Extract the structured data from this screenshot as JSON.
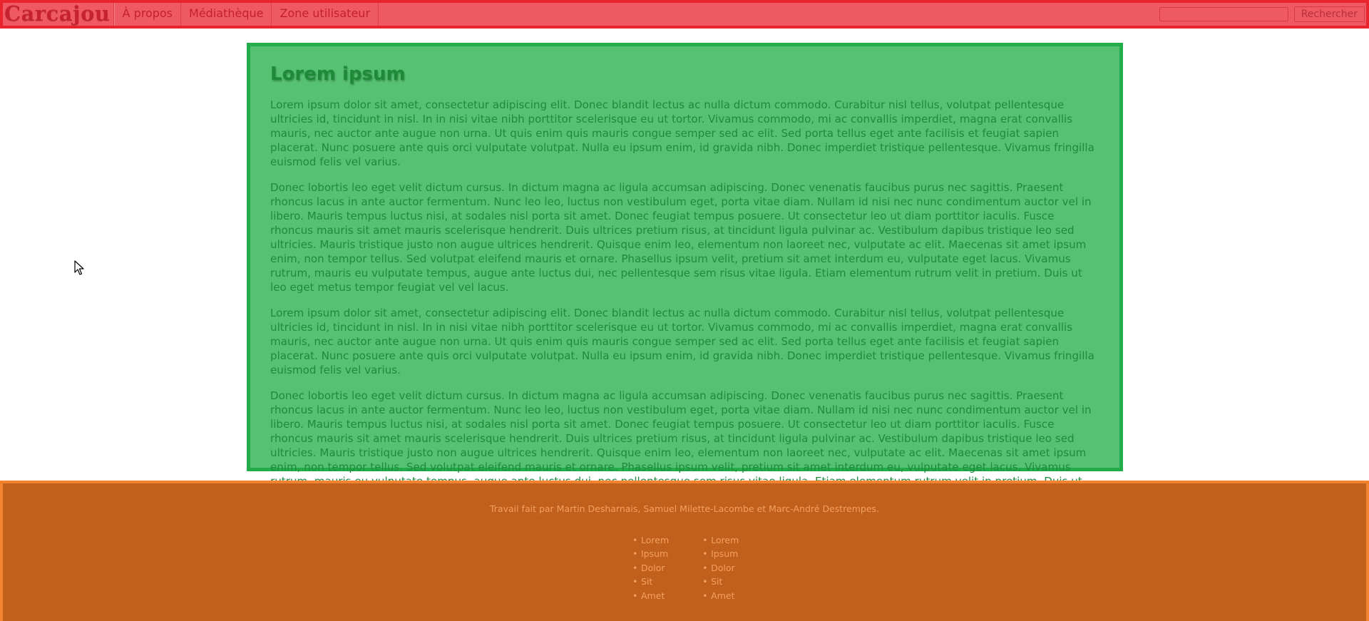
{
  "header": {
    "brand": "Carcajou",
    "nav": [
      "À propos",
      "Médiathèque",
      "Zone utilisateur"
    ],
    "search": {
      "value": "",
      "placeholder": "",
      "button_label": "Rechercher"
    }
  },
  "main": {
    "title": "Lorem ipsum",
    "paragraphs": [
      "Lorem ipsum dolor sit amet, consectetur adipiscing elit. Donec blandit lectus ac nulla dictum commodo. Curabitur nisl tellus, volutpat pellentesque ultricies id, tincidunt in nisl. In in nisi vitae nibh porttitor scelerisque eu ut tortor. Vivamus commodo, mi ac convallis imperdiet, magna erat convallis mauris, nec auctor ante augue non urna. Ut quis enim quis mauris congue semper sed ac elit. Sed porta tellus eget ante facilisis et feugiat sapien placerat. Nunc posuere ante quis orci vulputate volutpat. Nulla eu ipsum enim, id gravida nibh. Donec imperdiet tristique pellentesque. Vivamus fringilla euismod felis vel varius.",
      "Donec lobortis leo eget velit dictum cursus. In dictum magna ac ligula accumsan adipiscing. Donec venenatis faucibus purus nec sagittis. Praesent rhoncus lacus in ante auctor fermentum. Nunc leo leo, luctus non vestibulum eget, porta vitae diam. Nullam id nisi nec nunc condimentum auctor vel in libero. Mauris tempus luctus nisi, at sodales nisl porta sit amet. Donec feugiat tempus posuere. Ut consectetur leo ut diam porttitor iaculis. Fusce rhoncus mauris sit amet mauris scelerisque hendrerit. Duis ultrices pretium risus, at tincidunt ligula pulvinar ac. Vestibulum dapibus tristique leo sed ultricies. Mauris tristique justo non augue ultrices hendrerit. Quisque enim leo, elementum non laoreet nec, vulputate ac elit. Maecenas sit amet ipsum enim, non tempor tellus. Sed volutpat eleifend mauris et ornare. Phasellus ipsum velit, pretium sit amet interdum eu, vulputate eget lacus. Vivamus rutrum, mauris eu vulputate tempus, augue ante luctus dui, nec pellentesque sem risus vitae ligula. Etiam elementum rutrum velit in pretium. Duis ut leo eget metus tempor feugiat vel vel lacus.",
      "Lorem ipsum dolor sit amet, consectetur adipiscing elit. Donec blandit lectus ac nulla dictum commodo. Curabitur nisl tellus, volutpat pellentesque ultricies id, tincidunt in nisl. In in nisi vitae nibh porttitor scelerisque eu ut tortor. Vivamus commodo, mi ac convallis imperdiet, magna erat convallis mauris, nec auctor ante augue non urna. Ut quis enim quis mauris congue semper sed ac elit. Sed porta tellus eget ante facilisis et feugiat sapien placerat. Nunc posuere ante quis orci vulputate volutpat. Nulla eu ipsum enim, id gravida nibh. Donec imperdiet tristique pellentesque. Vivamus fringilla euismod felis vel varius.",
      "Donec lobortis leo eget velit dictum cursus. In dictum magna ac ligula accumsan adipiscing. Donec venenatis faucibus purus nec sagittis. Praesent rhoncus lacus in ante auctor fermentum. Nunc leo leo, luctus non vestibulum eget, porta vitae diam. Nullam id nisi nec nunc condimentum auctor vel in libero. Mauris tempus luctus nisi, at sodales nisl porta sit amet. Donec feugiat tempus posuere. Ut consectetur leo ut diam porttitor iaculis. Fusce rhoncus mauris sit amet mauris scelerisque hendrerit. Duis ultrices pretium risus, at tincidunt ligula pulvinar ac. Vestibulum dapibus tristique leo sed ultricies. Mauris tristique justo non augue ultrices hendrerit. Quisque enim leo, elementum non laoreet nec, vulputate ac elit. Maecenas sit amet ipsum enim, non tempor tellus. Sed volutpat eleifend mauris et ornare. Phasellus ipsum velit, pretium sit amet interdum eu, vulputate eget lacus. Vivamus rutrum, mauris eu vulputate tempus, augue ante luctus dui, nec pellentesque sem risus vitae ligula. Etiam elementum rutrum velit in pretium. Duis ut leo eget metus tempor feugiat vel vel lacus."
    ]
  },
  "footer": {
    "credit": "Travail fait par Martin Desharnais, Samuel Milette-Lacombe et Marc-André Destrempes.",
    "lists": [
      [
        "Lorem",
        "Ipsum",
        "Dolor",
        "Sit",
        "Amet"
      ],
      [
        "Lorem",
        "Ipsum",
        "Dolor",
        "Sit",
        "Amet"
      ]
    ]
  },
  "colors": {
    "header_bg": "#ef5964",
    "header_border": "#e8252f",
    "content_bg": "#57c173",
    "content_border": "#23ad4a",
    "footer_bg": "#c0601c",
    "footer_border": "#f4832f"
  },
  "icons": {
    "cursor": "mouse-pointer-icon"
  }
}
